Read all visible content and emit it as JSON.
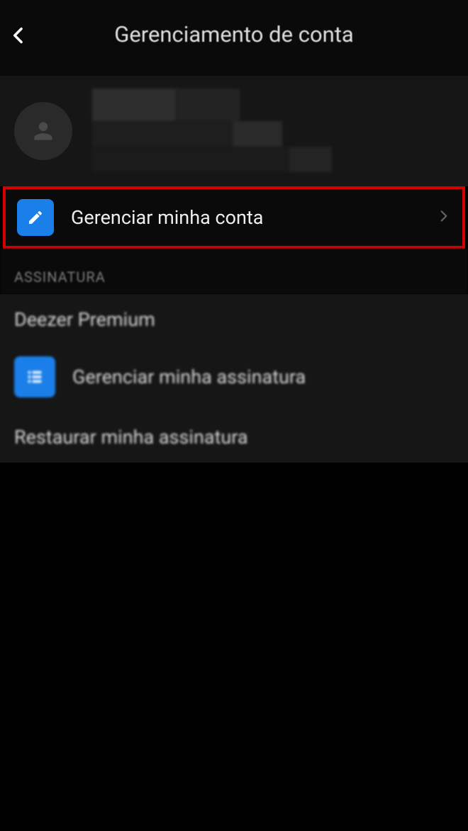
{
  "header": {
    "title": "Gerenciamento de conta"
  },
  "account": {
    "manage_label": "Gerenciar minha conta"
  },
  "subscription": {
    "section_label": "ASSINATURA",
    "plan_name": "Deezer Premium",
    "manage_label": "Gerenciar minha assinatura",
    "restore_label": "Restaurar minha assinatura"
  }
}
